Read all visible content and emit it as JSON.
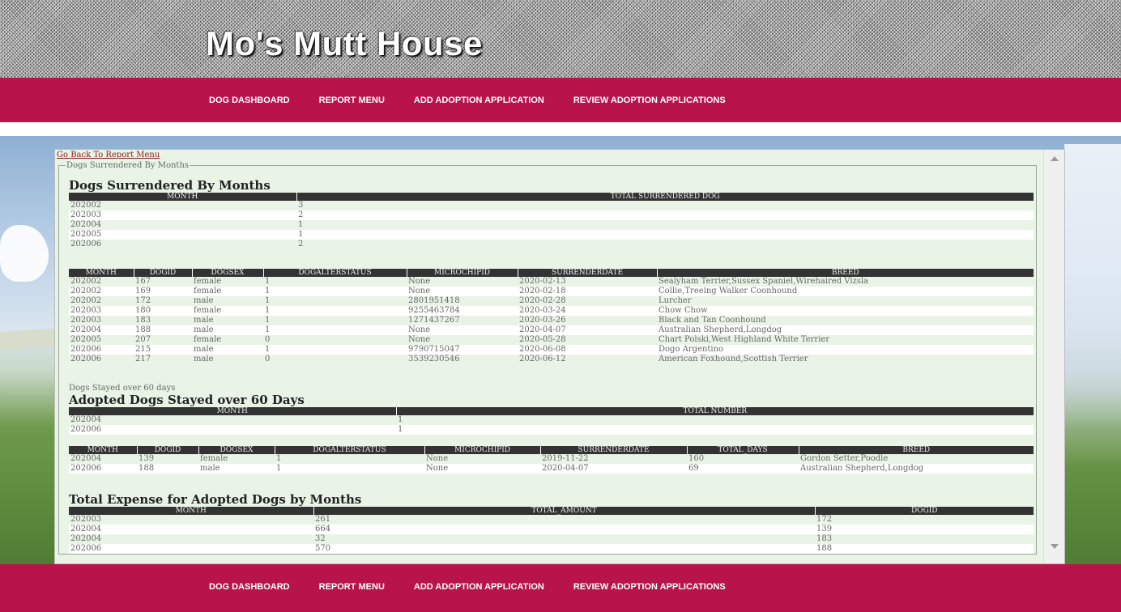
{
  "header": {
    "title": "Mo's Mutt House"
  },
  "nav": {
    "items": [
      "DOG DASHBOARD",
      "REPORT MENU",
      "ADD ADOPTION APPLICATION",
      "REVIEW ADOPTION APPLICATIONS"
    ]
  },
  "back_link": "Go Back To Report Menu",
  "fieldset_legend": "Dogs Surrendered By Months",
  "surrendered": {
    "heading": "Dogs Surrendered By Months",
    "headers": [
      "MONTH",
      "TOTAL SURRENDERED DOG"
    ],
    "rows": [
      [
        "202002",
        "3"
      ],
      [
        "202003",
        "2"
      ],
      [
        "202004",
        "1"
      ],
      [
        "202005",
        "1"
      ],
      [
        "202006",
        "2"
      ]
    ]
  },
  "surrendered_detail": {
    "headers": [
      "MONTH",
      "DOGID",
      "DOGSEX",
      "DOGALTERSTATUS",
      "MICROCHIPID",
      "SURRENDERDATE",
      "BREED"
    ],
    "rows": [
      [
        "202002",
        "167",
        "female",
        "1",
        "None",
        "2020-02-13",
        "Sealyham Terrier,Sussex Spaniel,Wirehaired Vizsla"
      ],
      [
        "202002",
        "169",
        "female",
        "1",
        "None",
        "2020-02-18",
        "Collie,Treeing Walker Coonhound"
      ],
      [
        "202002",
        "172",
        "male",
        "1",
        "2801951418",
        "2020-02-28",
        "Lurcher"
      ],
      [
        "202003",
        "180",
        "female",
        "1",
        "9255463784",
        "2020-03-24",
        "Chow Chow"
      ],
      [
        "202003",
        "183",
        "male",
        "1",
        "1271437267",
        "2020-03-26",
        "Black and Tan Coonhound"
      ],
      [
        "202004",
        "188",
        "male",
        "1",
        "None",
        "2020-04-07",
        "Australian Shepherd,Longdog"
      ],
      [
        "202005",
        "207",
        "female",
        "0",
        "None",
        "2020-05-28",
        "Chart Polski,West Highland White Terrier"
      ],
      [
        "202006",
        "215",
        "male",
        "1",
        "9790715047",
        "2020-06-08",
        "Dogo Argentino"
      ],
      [
        "202006",
        "217",
        "male",
        "0",
        "3539230546",
        "2020-06-12",
        "American Foxhound,Scottish Terrier"
      ]
    ]
  },
  "stayed": {
    "label": "Dogs Stayed over 60 days",
    "heading": "Adopted Dogs Stayed over 60 Days",
    "headers": [
      "MONTH",
      "TOTAL NUMBER"
    ],
    "rows": [
      [
        "202004",
        "1"
      ],
      [
        "202006",
        "1"
      ]
    ]
  },
  "stayed_detail": {
    "headers": [
      "MONTH",
      "DOGID",
      "DOGSEX",
      "DOGALTERSTATUS",
      "MICROCHIPID",
      "SURRENDERDATE",
      "TOTAL_DAYS",
      "BREED"
    ],
    "rows": [
      [
        "202004",
        "139",
        "female",
        "1",
        "None",
        "2019-11-22",
        "160",
        "Gordon Setter,Poodle"
      ],
      [
        "202006",
        "188",
        "male",
        "1",
        "None",
        "2020-04-07",
        "69",
        "Australian Shepherd,Longdog"
      ]
    ]
  },
  "expense": {
    "heading": "Total Expense for Adopted Dogs by Months",
    "headers": [
      "MONTH",
      "TOTAL_AMOUNT",
      "DOGID"
    ],
    "rows": [
      [
        "202003",
        "261",
        "172"
      ],
      [
        "202004",
        "664",
        "139"
      ],
      [
        "202004",
        "32",
        "183"
      ],
      [
        "202006",
        "570",
        "188"
      ]
    ]
  },
  "colors": {
    "nav": "#b8134a",
    "content_bg": "#e9f4e7",
    "table_header": "#333333"
  }
}
